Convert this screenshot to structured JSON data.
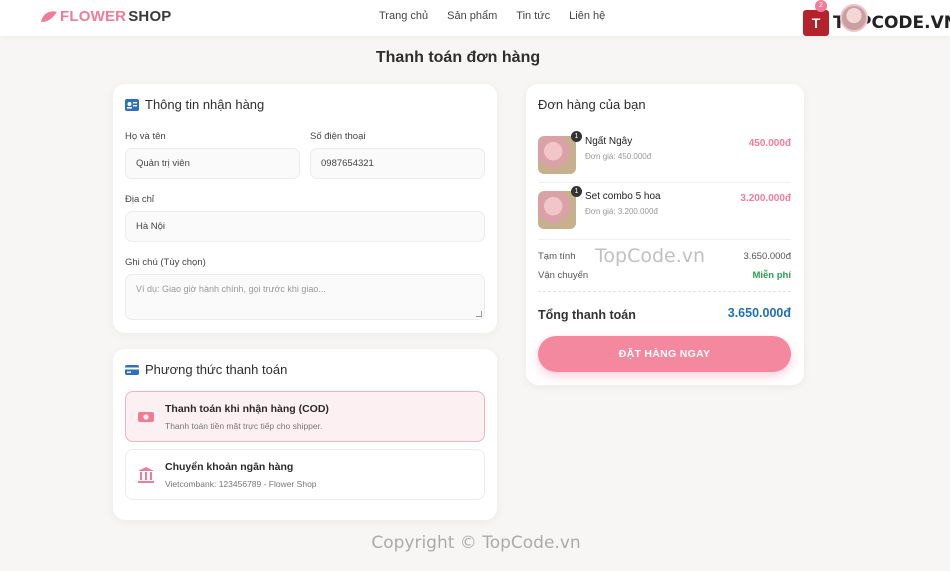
{
  "header": {
    "logo_part1": "FLOWER",
    "logo_part2": "SHOP",
    "nav": [
      "Trang chủ",
      "Sản phẩm",
      "Tin tức",
      "Liên hệ"
    ],
    "cart_badge": "2",
    "watermark_brand_box": "T",
    "watermark_brand_text": "TOPCODE.VN"
  },
  "page_title": "Thanh toán đơn hàng",
  "shipping": {
    "heading": "Thông tin nhận hàng",
    "name_label": "Họ và tên",
    "name_value": "Quản trị viên",
    "phone_label": "Số điện thoại",
    "phone_value": "0987654321",
    "address_label": "Địa chỉ",
    "address_value": "Hà Nội",
    "note_label": "Ghi chú (Tùy chọn)",
    "note_placeholder": "Ví dụ: Giao giờ hành chính, gọi trước khi giao..."
  },
  "payment": {
    "heading": "Phương thức thanh toán",
    "options": [
      {
        "title": "Thanh toán khi nhận hàng (COD)",
        "subtitle": "Thanh toán tiền mặt trực tiếp cho shipper.",
        "selected": true
      },
      {
        "title": "Chuyển khoản ngân hàng",
        "subtitle": "Vietcombank: 123456789 - Flower Shop",
        "selected": false
      }
    ]
  },
  "order": {
    "heading": "Đơn hàng của bạn",
    "items": [
      {
        "name": "Ngất Ngây",
        "unit": "Đơn giá: 450.000đ",
        "price": "450.000đ",
        "qty": "1"
      },
      {
        "name": "Set combo 5 hoa",
        "unit": "Đơn giá: 3.200.000đ",
        "price": "3.200.000đ",
        "qty": "1"
      }
    ],
    "subtotal_label": "Tạm tính",
    "subtotal_value": "3.650.000đ",
    "shipping_label": "Vận chuyển",
    "shipping_value": "Miễn phí",
    "total_label": "Tổng thanh toán",
    "total_value": "3.650.000đ",
    "order_button": "ĐẶT HÀNG NGAY"
  },
  "watermark_center": "TopCode.vn",
  "copyright": "Copyright © TopCode.vn",
  "colors": {
    "accent": "#f07c9a",
    "total": "#1f6fb8",
    "free": "#2e9e56"
  }
}
